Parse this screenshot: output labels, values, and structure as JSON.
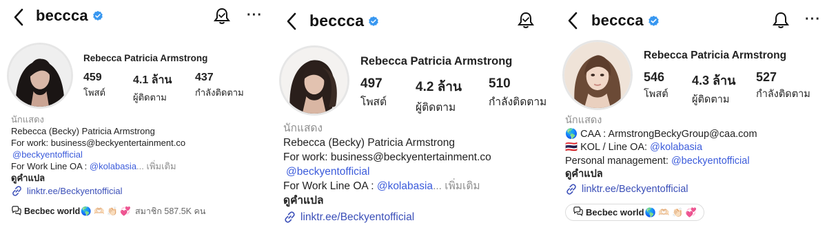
{
  "panels": [
    {
      "username": "beccca",
      "full_name": "Rebecca Patricia Armstrong",
      "stats": [
        {
          "value": "459",
          "label": "โพสต์"
        },
        {
          "value": "4.1 ล้าน",
          "label": "ผู้ติดตาม"
        },
        {
          "value": "437",
          "label": "กำลังติดตาม"
        }
      ],
      "category": "นักแสดง",
      "bio_name": "Rebecca (Becky) Patricia Armstrong",
      "bio_work": "For work: business@beckyentertainment.co",
      "bio_mention": "@beckyentofficial",
      "bio_line_prefix": "For Work Line OA : ",
      "bio_line_mention": "@kolabasia",
      "bio_more": "... เพิ่มเติม",
      "translate": "ดูคำแปล",
      "link": "linktr.ee/Beckyentofficial",
      "channel_name": "Becbec world",
      "channel_emojis": "🌎 🫶🏻 👏🏻 💞",
      "channel_members": "สมาชิก 587.5K คน"
    },
    {
      "username": "beccca",
      "full_name": "Rebecca Patricia Armstrong",
      "stats": [
        {
          "value": "497",
          "label": "โพสต์"
        },
        {
          "value": "4.2 ล้าน",
          "label": "ผู้ติดตาม"
        },
        {
          "value": "510",
          "label": "กำลังติดตาม"
        }
      ],
      "category": "นักแสดง",
      "bio_name": "Rebecca (Becky) Patricia Armstrong",
      "bio_work": "For work: business@beckyentertainment.co",
      "bio_mention": "@beckyentofficial",
      "bio_line_prefix": "For Work Line OA : ",
      "bio_line_mention": "@kolabasia",
      "bio_more": "... เพิ่มเติม",
      "translate": "ดูคำแปล",
      "link": "linktr.ee/Beckyentofficial"
    },
    {
      "username": "beccca",
      "full_name": "Rebecca Patricia Armstrong",
      "stats": [
        {
          "value": "546",
          "label": "โพสต์"
        },
        {
          "value": "4.3 ล้าน",
          "label": "ผู้ติดตาม"
        },
        {
          "value": "527",
          "label": "กำลังติดตาม"
        }
      ],
      "category": "นักแสดง",
      "caa_emoji": "🌎",
      "caa_text": "CAA : ArmstrongBeckyGroup@caa.com",
      "kol_flag": "🇹🇭",
      "kol_prefix": "KOL / Line OA: ",
      "kol_mention": "@kolabasia",
      "mgmt_prefix": "Personal management: ",
      "mgmt_mention": "@beckyentofficial",
      "translate": "ดูคำแปล",
      "link": "linktr.ee/Beckyentofficial",
      "channel_name": "Becbec world",
      "channel_emojis": "🌎 🫶🏻 👏🏻 💞"
    }
  ],
  "colors": {
    "verified": "#3897f0",
    "mention": "#3b5bdb",
    "link": "#3b4fb8",
    "muted": "#8e8e8e"
  },
  "icons": [
    "back-chevron-icon",
    "verified-badge-icon",
    "notification-bell-icon",
    "more-options-icon",
    "link-icon",
    "channel-icon"
  ]
}
